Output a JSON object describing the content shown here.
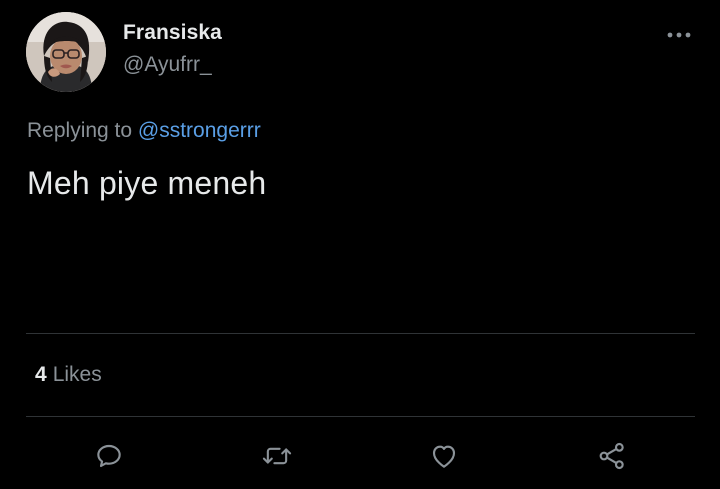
{
  "tweet": {
    "author": {
      "display_name": "Fransiska",
      "username": "@Ayufrr_",
      "avatar_icon": "avatar-photo"
    },
    "more_icon": "more-horizontal-icon",
    "replying_to": {
      "prefix": "Replying to",
      "mention": "@sstrongerrr"
    },
    "text": "Meh piye meneh",
    "stats": {
      "likes_count": "4",
      "likes_label": "Likes"
    },
    "actions": [
      {
        "name": "reply",
        "icon": "comment-icon"
      },
      {
        "name": "retweet",
        "icon": "retweet-icon"
      },
      {
        "name": "like",
        "icon": "heart-icon"
      },
      {
        "name": "share",
        "icon": "share-icon"
      }
    ]
  },
  "colors": {
    "background": "#000000",
    "primary_text": "#e7e9ea",
    "secondary_text": "#8b9298",
    "link": "#5a9fe6",
    "divider": "#2f3336"
  }
}
